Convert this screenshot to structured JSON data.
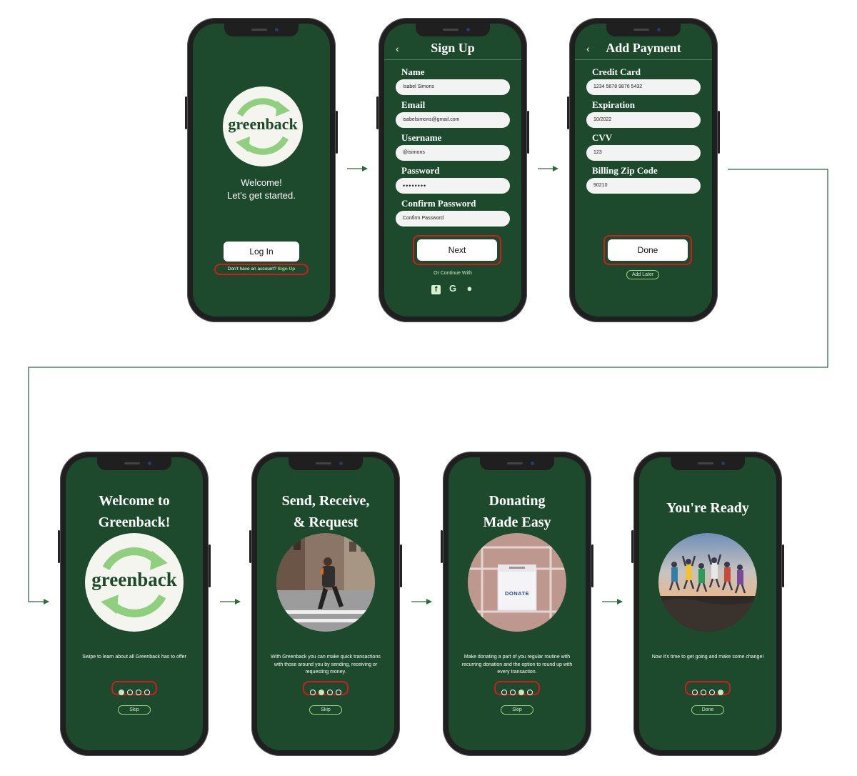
{
  "brand": {
    "name": "greenback",
    "colors": {
      "screen": "#1d4a2c",
      "accent_green": "#9ed68a",
      "logo_arrow": "#8fcf7e",
      "highlight": "#d21c1c",
      "connector": "#2f6b3d"
    }
  },
  "screens": {
    "landing": {
      "welcome_line1": "Welcome!",
      "welcome_line2": "Let's get started.",
      "login_label": "Log In",
      "signup_prompt": "Don't have an account?",
      "signup_link": "Sign Up"
    },
    "signup": {
      "back_icon": "chevron-left-icon",
      "title": "Sign Up",
      "name_label": "Name",
      "name_value": "Isabel Simons",
      "email_label": "Email",
      "email_value": "isabelsimons@gmail.com",
      "username_label": "Username",
      "username_value": "@isimons",
      "password_label": "Password",
      "password_value": "••••••••",
      "confirm_label": "Confirm Password",
      "confirm_placeholder": "Confirm Password",
      "next_label": "Next",
      "continue_with": "Or Continue With",
      "social_icons": [
        "facebook-icon",
        "google-icon",
        "apple-icon"
      ]
    },
    "payment": {
      "title": "Add Payment",
      "card_label": "Credit Card",
      "card_value": "1234 5678 9876 5432",
      "exp_label": "Expiration",
      "exp_value": "10/2022",
      "cvv_label": "CVV",
      "cvv_value": "123",
      "zip_label": "Billing Zip Code",
      "zip_value": "90210",
      "done_label": "Done",
      "later_label": "Add Later"
    },
    "onboard1": {
      "title_line1": "Welcome to",
      "title_line2": "Greenback!",
      "text": "Swipe to learn about all Greenback has to offer",
      "active_dot": 0,
      "skip_label": "Skip"
    },
    "onboard2": {
      "title_line1": "Send, Receive,",
      "title_line2": "& Request",
      "text": "With Greenback you can make quick transactions with those around you by sending, receiving or requesting money.",
      "active_dot": 1,
      "skip_label": "Skip"
    },
    "onboard3": {
      "title_line1": "Donating",
      "title_line2": "Made Easy",
      "box_label": "DONATE",
      "text": "Make donating a part of you regular routine with recurring donation and the option to round up with every transaction.",
      "active_dot": 2,
      "skip_label": "Skip"
    },
    "onboard4": {
      "title": "You're Ready",
      "text": "Now it's time to get going and make some change!",
      "active_dot": 3,
      "done_label": "Done"
    }
  }
}
